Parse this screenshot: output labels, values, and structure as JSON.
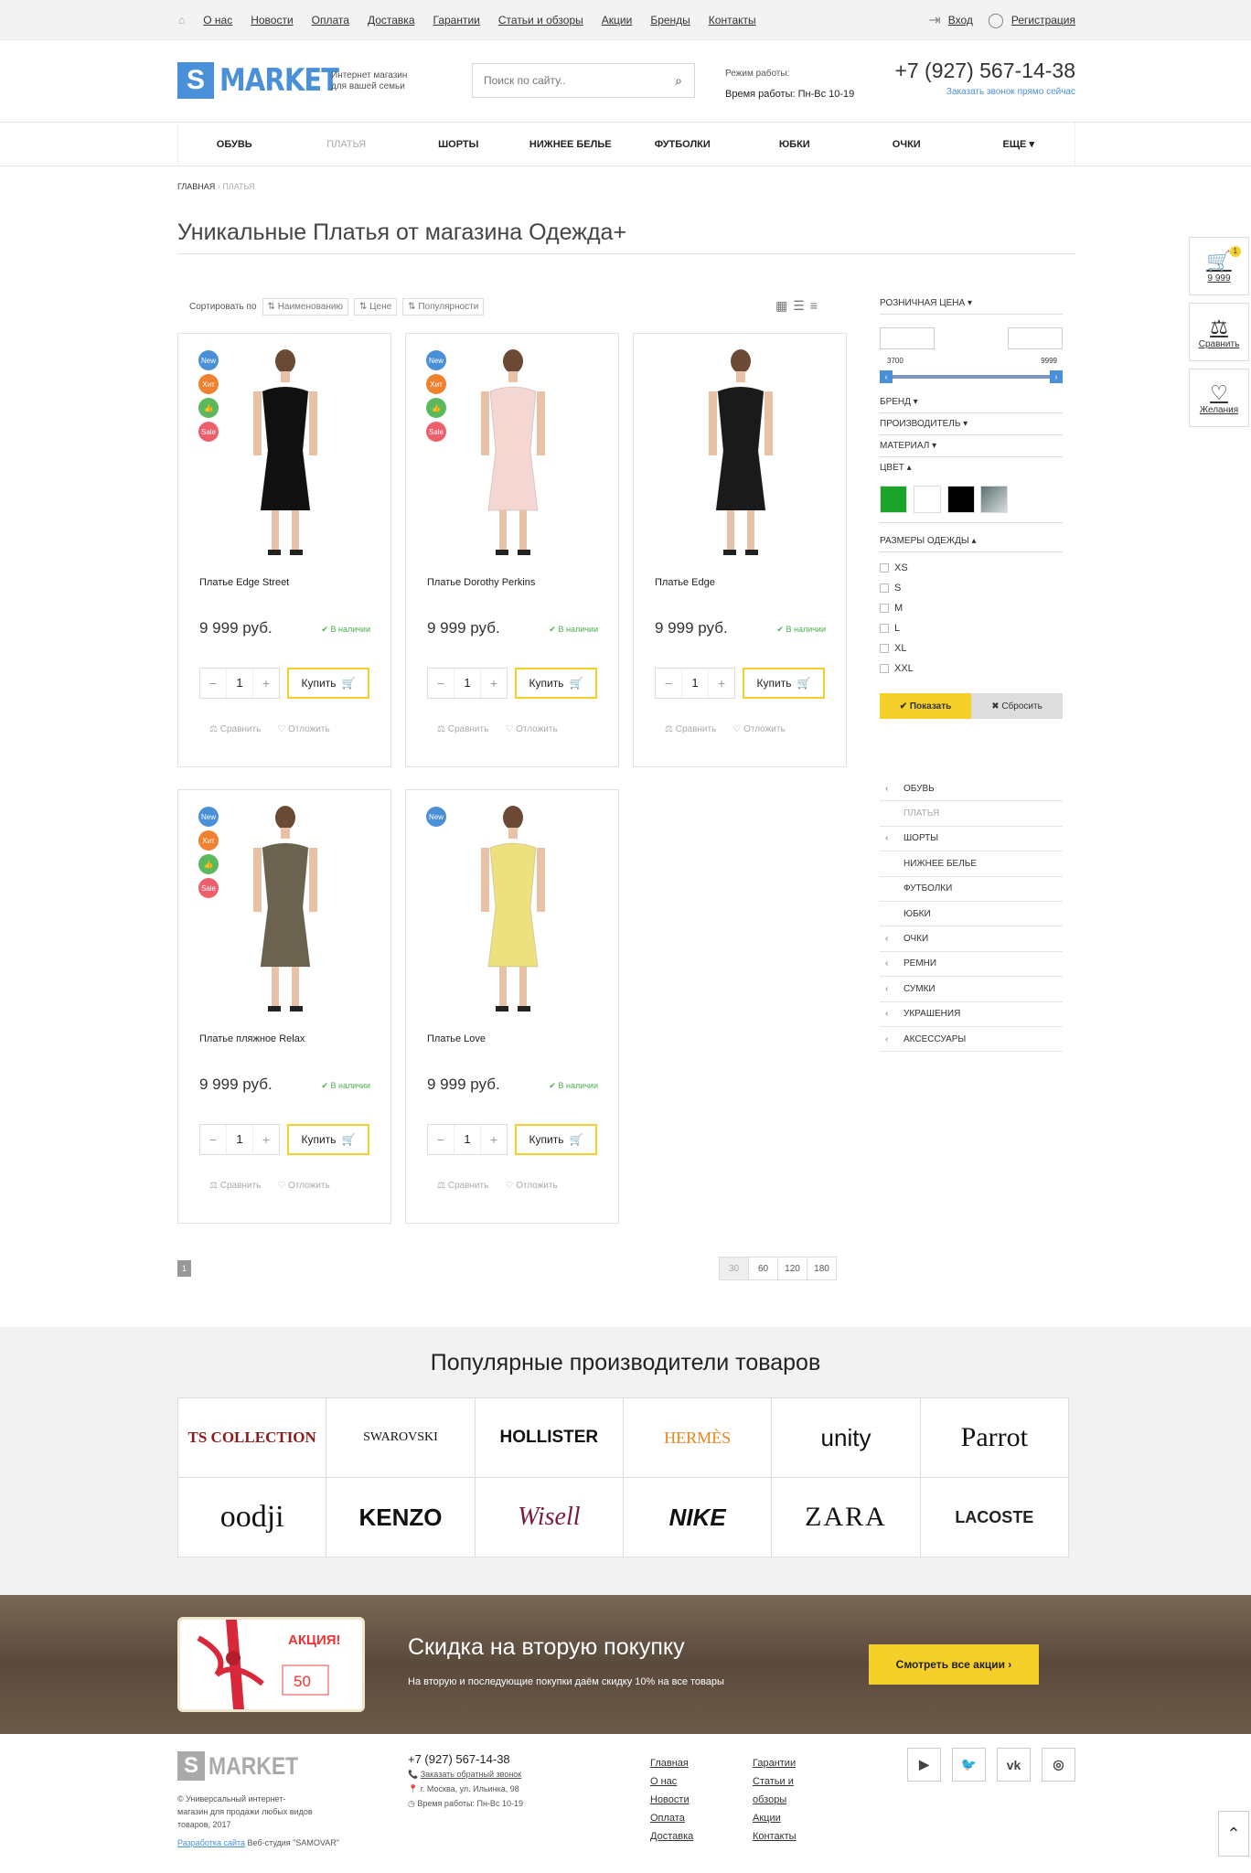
{
  "topnav": [
    "О нас",
    "Новости",
    "Оплата",
    "Доставка",
    "Гарантии",
    "Статьи и обзоры",
    "Акции",
    "Бренды",
    "Контакты"
  ],
  "auth": {
    "login": "Вход",
    "register": "Регистрация"
  },
  "header": {
    "logo_s": "S",
    "logo_text": "MARKET",
    "tagline": "Интернет магазин для вашей семьи",
    "search_placeholder": "Поиск по сайту..",
    "hours_label": "Режим работы:",
    "hours": "Время работы: Пн-Вс 10-19",
    "phone": "+7 (927) 567-14-38",
    "callback": "Заказать звонок прямо сейчас"
  },
  "catnav": [
    "ОБУВЬ",
    "ПЛАТЬЯ",
    "ШОРТЫ",
    "НИЖНЕЕ БЕЛЬЕ",
    "ФУТБОЛКИ",
    "ЮБКИ",
    "ОЧКИ",
    "ЕЩЕ ▾"
  ],
  "breadcrumb": {
    "home": "ГЛАВНАЯ",
    "current": "ПЛАТЬЯ"
  },
  "title": "Уникальные Платья от магазина Одежда+",
  "sort": {
    "label": "Сортировать по",
    "by_name": "Наименованию",
    "by_price": "Цене",
    "by_pop": "Популярности"
  },
  "products": [
    {
      "name": "Платье Edge Street",
      "price": "9 999 руб.",
      "stock": "В наличии",
      "qty": "1",
      "buy": "Купить",
      "compare": "Сравнить",
      "defer": "Отложить",
      "badges": [
        "New",
        "Хит",
        "👍",
        "Sale"
      ],
      "dress": "#111111"
    },
    {
      "name": "Платье Dorothy Perkins",
      "price": "9 999 руб.",
      "stock": "В наличии",
      "qty": "1",
      "buy": "Купить",
      "compare": "Сравнить",
      "defer": "Отложить",
      "badges": [
        "New",
        "Хит",
        "👍",
        "Sale"
      ],
      "dress": "#f4d6d2"
    },
    {
      "name": "Платье Edge",
      "price": "9 999 руб.",
      "stock": "В наличии",
      "qty": "1",
      "buy": "Купить",
      "compare": "Сравнить",
      "defer": "Отложить",
      "badges": [],
      "dress": "#1a1a1a"
    },
    {
      "name": "Платье пляжное Relax",
      "price": "9 999 руб.",
      "stock": "В наличии",
      "qty": "1",
      "buy": "Купить",
      "compare": "Сравнить",
      "defer": "Отложить",
      "badges": [
        "New",
        "Хит",
        "👍",
        "Sale"
      ],
      "dress": "#6b6350"
    },
    {
      "name": "Платье Love",
      "price": "9 999 руб.",
      "stock": "В наличии",
      "qty": "1",
      "buy": "Купить",
      "compare": "Сравнить",
      "defer": "Отложить",
      "badges": [
        "New"
      ],
      "dress": "#ede07f"
    }
  ],
  "pagination": {
    "current": "1",
    "per_page": [
      "30",
      "60",
      "120",
      "180"
    ]
  },
  "filter": {
    "price": "РОЗНИЧНАЯ ЦЕНА ▾",
    "min": "3700",
    "max": "9999",
    "brand": "БРЕНД ▾",
    "maker": "ПРОИЗВОДИТЕЛЬ ▾",
    "material": "МАТЕРИАЛ ▾",
    "color": "ЦВЕТ ▴",
    "swatches": [
      "#1aa52a",
      "#ffffff",
      "#000000",
      "#7a8a8a"
    ],
    "sizes_title": "РАЗМЕРЫ ОДЕЖДЫ ▴",
    "sizes": [
      "XS",
      "S",
      "M",
      "L",
      "XL",
      "XXL"
    ],
    "show": "✔ Показать",
    "reset": "✖ Сбросить"
  },
  "catlist": [
    {
      "label": "ОБУВЬ",
      "arrow": true
    },
    {
      "label": "ПЛАТЬЯ",
      "arrow": false,
      "dim": true
    },
    {
      "label": "ШОРТЫ",
      "arrow": true
    },
    {
      "label": "НИЖНЕЕ БЕЛЬЕ",
      "arrow": false
    },
    {
      "label": "ФУТБОЛКИ",
      "arrow": false
    },
    {
      "label": "ЮБКИ",
      "arrow": false
    },
    {
      "label": "ОЧКИ",
      "arrow": true
    },
    {
      "label": "РЕМНИ",
      "arrow": true
    },
    {
      "label": "СУМКИ",
      "arrow": true
    },
    {
      "label": "УКРАШЕНИЯ",
      "arrow": true
    },
    {
      "label": "АКСЕССУАРЫ",
      "arrow": true
    }
  ],
  "side_tabs": {
    "cart_count": "1",
    "cart_sum": "9 999",
    "compare": "Сравнить",
    "wish": "Желания"
  },
  "brands": {
    "title": "Популярные производители товаров",
    "items": [
      "TS COLLECTION",
      "SWAROVSKI",
      "HOLLISTER",
      "HERMÈS",
      "unity",
      "Parrot",
      "oodji",
      "KENZO",
      "Wisell",
      "NIKE",
      "ZARA",
      "LACOSTE"
    ]
  },
  "promo": {
    "title": "Скидка на вторую покупку",
    "text": "На вторую и последующие покупки даём скидку 10% на все товары",
    "button": "Смотреть все акции ›",
    "gift_label": "АКЦИЯ!",
    "gift_value": "50"
  },
  "footer": {
    "desc": "© Универсальный интернет-магазин для продажи любых видов товаров, 2017",
    "dev_link": "Разработка сайта",
    "dev_text": "Веб-студия \"SAMOVAR\"",
    "phone": "+7 (927) 567-14-38",
    "callback": "Заказать обратный звонок",
    "address": "г. Москва, ул. Ильинка, 98",
    "hours": "Время работы: Пн-Вс 10-19",
    "links1": [
      "Главная",
      "О нас",
      "Новости",
      "Оплата",
      "Доставка"
    ],
    "links2": [
      "Гарантии",
      "Статьи и",
      "обзоры",
      "Акции",
      "Контакты"
    ]
  }
}
